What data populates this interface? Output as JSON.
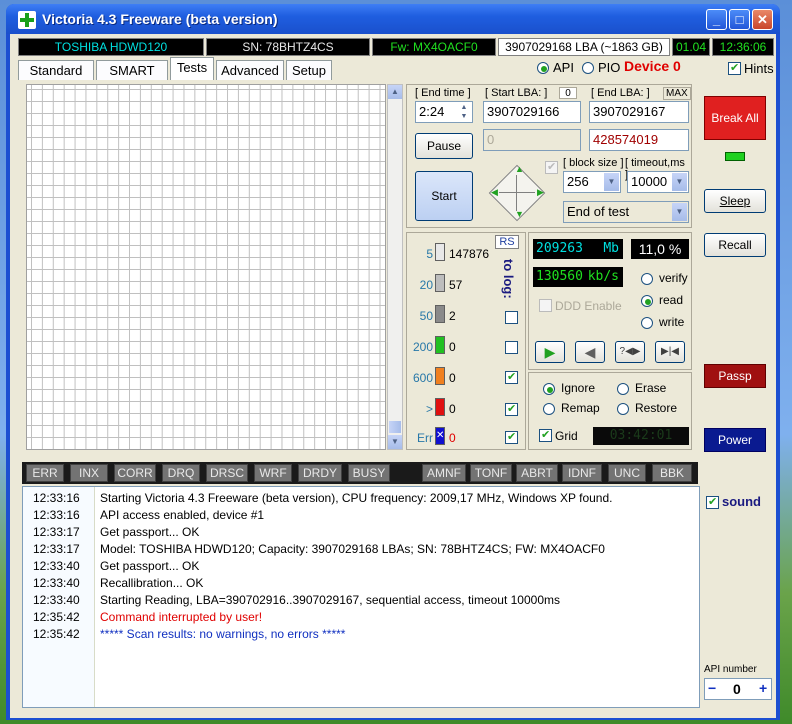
{
  "window": {
    "title": "Victoria 4.3 Freeware (beta version)",
    "minimize": "_",
    "maximize": "□",
    "close": "✕"
  },
  "statusbar": {
    "model": "TOSHIBA HDWD120",
    "serial": "SN: 78BHTZ4CS",
    "firmware": "Fw: MX4OACF0",
    "lba": "3907029168 LBA (~1863 GB)",
    "date": "01.04",
    "time": "12:36:06"
  },
  "tabs": [
    {
      "label": "Standard"
    },
    {
      "label": "SMART"
    },
    {
      "label": "Tests"
    },
    {
      "label": "Advanced"
    },
    {
      "label": "Setup"
    }
  ],
  "mode": {
    "api": "API",
    "pio": "PIO",
    "device": "Device 0",
    "hints": "Hints"
  },
  "controls": {
    "end_time_label": "[ End time ]",
    "end_time_value": "2:24",
    "start_lba_label": "[ Start LBA: ]",
    "start_lba_mini": "0",
    "start_lba_value": "3907029166",
    "end_lba_label": "[ End LBA: ]",
    "max_label": "MAX",
    "end_lba_value": "3907029167",
    "current_value": "0",
    "current_lba": "428574019",
    "pause": "Pause",
    "start": "Start",
    "block_size_label": "[ block size ]",
    "block_size_value": "256",
    "timeout_label": "[ timeout,ms ]",
    "timeout_value": "10000",
    "end_action": "End of test"
  },
  "histogram": {
    "rs_label": "RS",
    "to_log": "to log:",
    "rows": [
      {
        "label": "5",
        "count": "147876",
        "color": "#e8e8e8"
      },
      {
        "label": "20",
        "count": "57",
        "color": "#bdbdbd"
      },
      {
        "label": "50",
        "count": "2",
        "color": "#8a8a8a"
      },
      {
        "label": "200",
        "count": "0",
        "color": "#21c021"
      },
      {
        "label": "600",
        "count": "0",
        "color": "#f08020"
      },
      {
        "label": ">",
        "count": "0",
        "color": "#e01010"
      },
      {
        "label": "Err",
        "count": "0",
        "color": "#1010d0"
      }
    ]
  },
  "stats": {
    "mb": "209263",
    "mb_unit": "Mb",
    "percent": "11,0 %",
    "speed": "130560",
    "speed_unit": "kb/s",
    "ddd_enable": "DDD Enable",
    "verify": "verify",
    "read": "read",
    "write": "write",
    "play_icon": "▶",
    "back_icon": "◀",
    "skip_icon": "?◀▶",
    "end_icon": "▶|◀"
  },
  "repair": {
    "ignore": "Ignore",
    "erase": "Erase",
    "remap": "Remap",
    "restore": "Restore",
    "grid": "Grid",
    "elapsed": "03:42:01"
  },
  "right_panel": {
    "break_all": "Break All",
    "sleep": "Sleep",
    "recall": "Recall",
    "passp": "Passp",
    "power": "Power",
    "sound": "sound",
    "api_number_label": "API number",
    "api_minus": "−",
    "api_number": "0",
    "api_plus": "+"
  },
  "flags": [
    "ERR",
    "INX",
    "CORR",
    "DRQ",
    "DRSC",
    "WRF",
    "DRDY",
    "BUSY",
    "AMNF",
    "TONF",
    "ABRT",
    "IDNF",
    "UNC",
    "BBK"
  ],
  "log": [
    {
      "time": "12:33:16",
      "msg": "Starting Victoria 4.3 Freeware (beta version), CPU frequency: 2009,17 MHz, Windows XP found.",
      "color": "#000000"
    },
    {
      "time": "12:33:16",
      "msg": "API access enabled, device #1",
      "color": "#000000"
    },
    {
      "time": "12:33:17",
      "msg": "Get passport... OK",
      "color": "#000000"
    },
    {
      "time": "12:33:17",
      "msg": "Model: TOSHIBA HDWD120; Capacity: 3907029168 LBAs; SN: 78BHTZ4CS; FW: MX4OACF0",
      "color": "#000000"
    },
    {
      "time": "12:33:40",
      "msg": "Get passport... OK",
      "color": "#000000"
    },
    {
      "time": "12:33:40",
      "msg": "Recallibration... OK",
      "color": "#000000"
    },
    {
      "time": "12:33:40",
      "msg": "Starting Reading, LBA=390702916..3907029167, sequential access, timeout 10000ms",
      "color": "#000000"
    },
    {
      "time": "12:35:42",
      "msg": "Command interrupted by user!",
      "color": "#e00000"
    },
    {
      "time": "12:35:42",
      "msg": "***** Scan results: no warnings, no errors *****",
      "color": "#1030c0"
    }
  ]
}
